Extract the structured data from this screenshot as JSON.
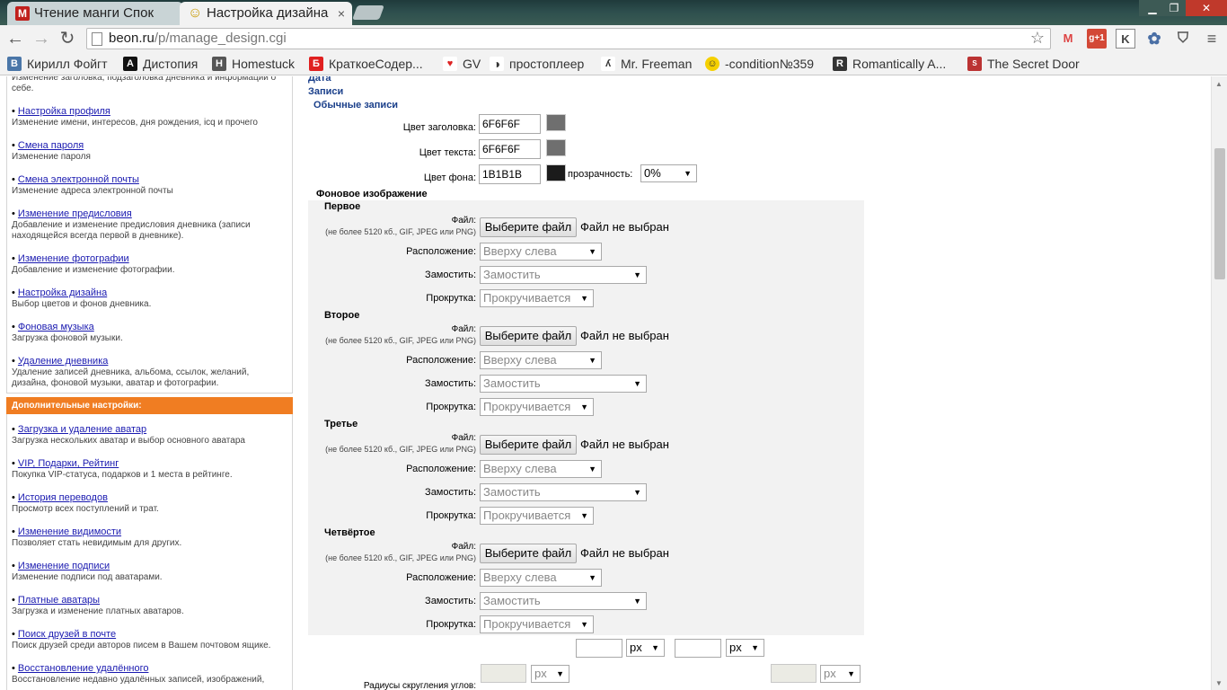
{
  "browser": {
    "tabs": [
      {
        "title": "Чтение манги Спок",
        "favicon": "M",
        "active": false
      },
      {
        "title": "Настройка дизайна",
        "favicon": "☺",
        "active": true
      }
    ],
    "window_controls": [
      "minimize",
      "maximize",
      "close"
    ],
    "url_host": "beon.ru",
    "url_path": "/p/manage_design.cgi",
    "bookmarks": [
      {
        "label": "Кирилл Фойгт",
        "icon": "vk-icon"
      },
      {
        "label": "Дистопия",
        "icon": "a-icon"
      },
      {
        "label": "Homestuck",
        "icon": "homestuck-icon"
      },
      {
        "label": "КраткоеСодер...",
        "icon": "b-icon"
      },
      {
        "label": "GV",
        "icon": "gv-icon"
      },
      {
        "label": "простоплеер",
        "icon": "music-icon"
      },
      {
        "label": "Mr. Freeman",
        "icon": "freeman-icon"
      },
      {
        "label": "-condition№359",
        "icon": "smiley-icon"
      },
      {
        "label": "Romantically A...",
        "icon": "ra-icon"
      },
      {
        "label": "The Secret Door",
        "icon": "sale-icon"
      }
    ]
  },
  "sidebar": {
    "top_fragment": "Изменение заголовка, подзаголовка дневника и информации о себе.",
    "items": [
      {
        "link": "Настройка профиля",
        "desc": "Изменение имени, интересов, дня рождения, icq и прочего"
      },
      {
        "link": "Смена пароля",
        "desc": "Изменение пароля"
      },
      {
        "link": "Смена электронной почты",
        "desc": "Изменение адреса электронной почты"
      },
      {
        "link": "Изменение предисловия",
        "desc": "Добавление и изменение предисловия дневника (записи находящейся всегда первой в дневнике)."
      },
      {
        "link": "Изменение фотографии",
        "desc": "Добавление и изменение фотографии."
      },
      {
        "link": "Настройка дизайна",
        "desc": "Выбор цветов и фонов дневника."
      },
      {
        "link": "Фоновая музыка",
        "desc": "Загрузка фоновой музыки."
      },
      {
        "link": "Удаление дневника",
        "desc": "Удаление записей дневника, альбома, ссылок, желаний, дизайна, фоновой музыки, аватар и фотографии."
      }
    ],
    "extra_header": "Дополнительные настройки:",
    "extra_items": [
      {
        "link": "Загрузка и удаление аватар",
        "desc": "Загрузка нескольких аватар и выбор основного аватара"
      },
      {
        "link": "VIP, Подарки, Рейтинг",
        "desc": "Покупка VIP-статуса, подарков и 1 места в рейтинге."
      },
      {
        "link": "История переводов",
        "desc": "Просмотр всех поступлений и трат."
      },
      {
        "link": "Изменение видимости",
        "desc": "Позволяет стать невидимым для других."
      },
      {
        "link": "Изменение подписи",
        "desc": "Изменение подписи под аватарами."
      },
      {
        "link": "Платные аватары",
        "desc": "Загрузка и изменение платных аватаров."
      },
      {
        "link": "Поиск друзей в почте",
        "desc": "Поиск друзей среди авторов писем в Вашем почтовом ящике."
      },
      {
        "link": "Восстановление удалённого",
        "desc": "Восстановление недавно удалённых записей, изображений,"
      }
    ]
  },
  "main": {
    "date_label": "Дата",
    "records_label": "Записи",
    "ordinary_label": "Обычные записи",
    "title_color_label": "Цвет заголовка:",
    "title_color": "6F6F6F",
    "text_color_label": "Цвет текста:",
    "text_color": "6F6F6F",
    "bg_color_label": "Цвет фона:",
    "bg_color": "1B1B1B",
    "transparency_label": "прозрачность:",
    "transparency": "0%",
    "swatch_colors": [
      "#6f6f6f",
      "#6f6f6f",
      "#1b1b1b"
    ],
    "bg_image_label": "Фоновое изображение",
    "file_label": "Файл:",
    "file_hint": "(не более 5120 кб., GIF, JPEG или PNG)",
    "file_button": "Выберите файл",
    "no_file": "Файл не выбран",
    "position_label": "Расположение:",
    "position_value": "Вверху слева",
    "tile_label": "Замостить:",
    "tile_value": "Замостить",
    "scroll_label": "Прокрутка:",
    "scroll_value": "Прокручивается",
    "images": [
      {
        "title": "Первое"
      },
      {
        "title": "Второе"
      },
      {
        "title": "Третье"
      },
      {
        "title": "Четвёртое"
      }
    ],
    "unit_px": "px",
    "corner_radius_label": "Радиусы скругления углов:"
  }
}
